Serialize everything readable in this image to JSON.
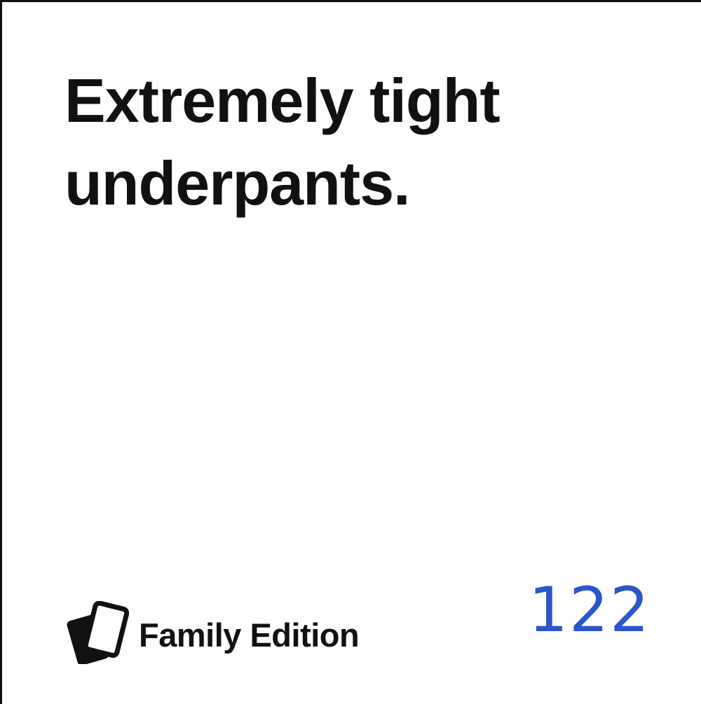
{
  "card": {
    "text": "Extremely tight underpants.",
    "brand_label": "Family Edition",
    "brand_icon": "cards-icon",
    "number": "122"
  },
  "colors": {
    "text": "#111111",
    "number": "#2b55c9",
    "background": "#ffffff"
  }
}
